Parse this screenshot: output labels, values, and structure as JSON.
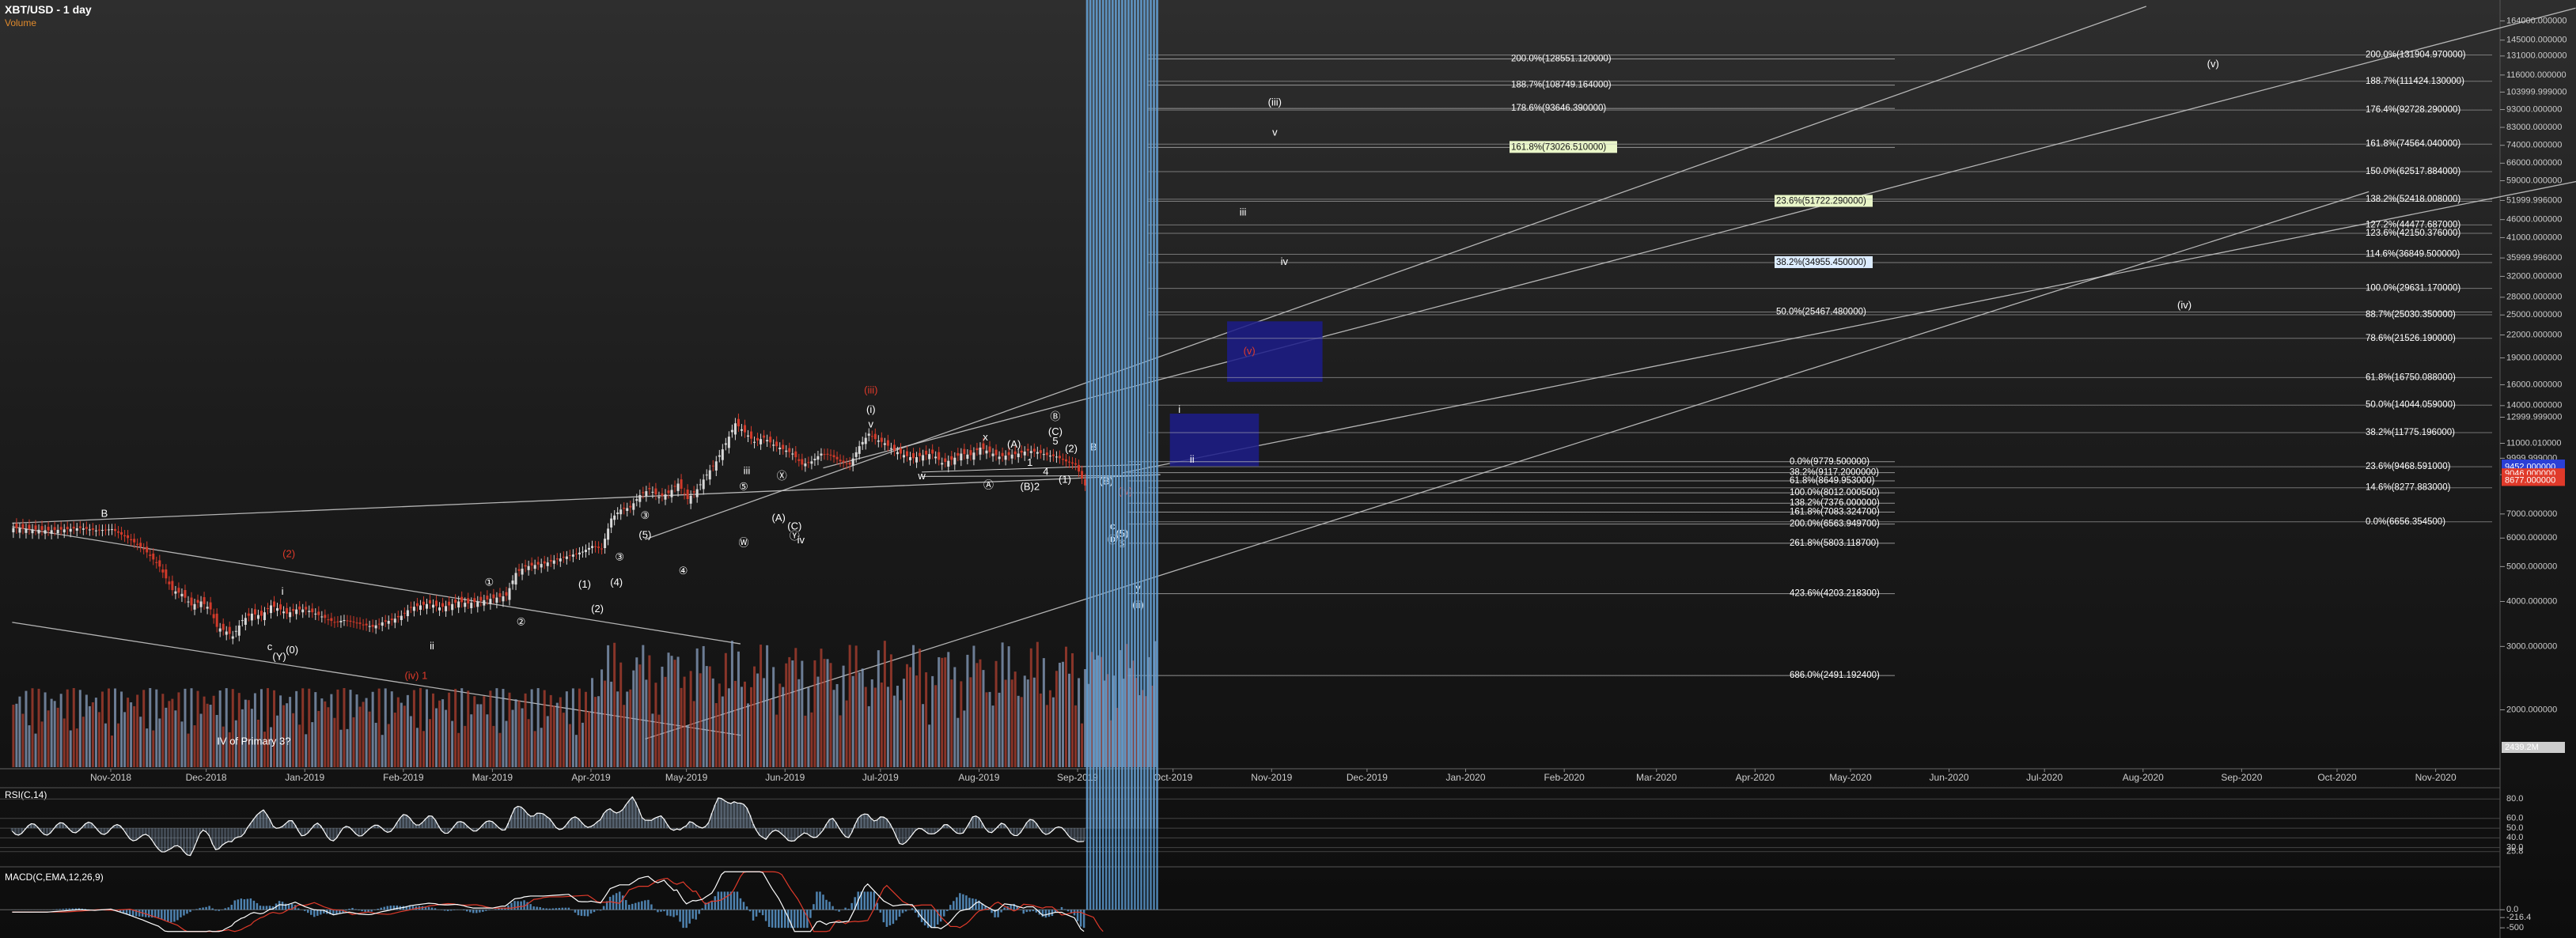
{
  "header": {
    "title": "XBT/USD - 1 day",
    "subtitle": "Volume"
  },
  "colors": {
    "up": "#d9d9d9",
    "down": "#d23a2a",
    "fib_line": "#bdbdbd",
    "channel": "#cfcfcf",
    "box": "#1c1c8a",
    "rsi_fill": "#8aa0b8",
    "macd_fast": "#ffffff",
    "macd_slow": "#e03a2a",
    "hist": "#5fa0d8",
    "volume_avg": "#b5651d"
  },
  "chart_data": {
    "type": "line",
    "title": "XBT/USD - 1 day",
    "price_axis": {
      "scale": "log",
      "ylim": [
        1400,
        180000
      ],
      "ticks": [
        "164000.000000",
        "145000.000000",
        "131000.000000",
        "116000.000000",
        "103999.999000",
        "93000.000000",
        "83000.000000",
        "74000.000000",
        "66000.000000",
        "59000.000000",
        "51999.996000",
        "46000.000000",
        "41000.000000",
        "35999.996000",
        "32000.000000",
        "28000.000000",
        "25000.000000",
        "22000.000000",
        "19000.000000",
        "16000.000000",
        "14000.000000",
        "12999.999000",
        "11000.010000",
        "9999.999000",
        "8999.999000",
        "7000.000000",
        "6000.000000",
        "5000.000000",
        "4000.000000",
        "3000.000000",
        "2000.000000"
      ],
      "tick_values": [
        164000,
        145000,
        131000,
        116000,
        104000,
        93000,
        83000,
        74000,
        66000,
        59000,
        52000,
        46000,
        41000,
        36000,
        32000,
        28000,
        25000,
        22000,
        19000,
        16000,
        14000,
        13000,
        11000,
        10000,
        9000,
        7000,
        6000,
        5000,
        4000,
        3000,
        2000
      ],
      "highlight_labels": [
        {
          "text": "9570.000000",
          "value": 9570,
          "color": "#2a3fd6"
        },
        {
          "text": "9452.000000",
          "value": 9452,
          "color": "#2a3fd6"
        },
        {
          "text": "9046.000000",
          "value": 9046,
          "color": "#e03a2a"
        },
        {
          "text": "8677.000000",
          "value": 8677,
          "color": "#e03a2a"
        },
        {
          "text": "2439.2M",
          "value": null,
          "color": "#cccccc"
        }
      ]
    },
    "time_axis": {
      "labels": [
        "Nov-2018",
        "Dec-2018",
        "Jan-2019",
        "Feb-2019",
        "Mar-2019",
        "Apr-2019",
        "May-2019",
        "Jun-2019",
        "Jul-2019",
        "Aug-2019",
        "Sep-2019",
        "Oct-2019",
        "Nov-2019",
        "Dec-2019",
        "Jan-2020",
        "Feb-2020",
        "Mar-2020",
        "Apr-2020",
        "May-2020",
        "Jun-2020",
        "Jul-2020",
        "Aug-2020",
        "Sep-2020",
        "Oct-2020",
        "Nov-2020"
      ],
      "label_days": [
        0,
        30,
        61,
        92,
        120,
        151,
        181,
        212,
        242,
        273,
        304,
        334,
        365,
        395,
        426,
        457,
        486,
        517,
        547,
        578,
        608,
        639,
        670,
        700,
        731
      ]
    },
    "price_series": {
      "name": "XBT/USD",
      "days": [
        -31,
        -20,
        -14,
        -10,
        -5,
        0,
        5,
        10,
        15,
        19,
        22,
        25,
        28,
        31,
        33,
        36,
        38,
        41,
        44,
        47,
        50,
        53,
        55,
        58,
        61,
        64,
        67,
        70,
        73,
        76,
        79,
        82,
        85,
        88,
        91,
        94,
        97,
        100,
        103,
        106,
        109,
        112,
        115,
        118,
        121,
        124,
        127,
        130,
        133,
        136,
        139,
        142,
        145,
        148,
        151,
        154,
        157,
        160,
        163,
        166,
        169,
        172,
        175,
        178,
        181,
        184,
        187,
        190,
        193,
        196,
        199,
        202,
        205,
        208,
        211,
        214,
        217,
        220,
        223,
        226,
        229,
        232,
        235,
        238,
        240,
        243,
        246,
        249,
        252,
        255,
        258,
        261,
        264,
        267,
        270,
        273,
        276,
        279,
        282,
        285,
        288,
        291,
        294,
        297,
        300,
        303,
        306,
        309,
        312,
        315,
        318,
        321,
        324,
        326,
        329
      ],
      "close": [
        6400,
        6300,
        6350,
        6400,
        6300,
        6350,
        6000,
        5600,
        5000,
        4300,
        4200,
        3900,
        4000,
        3800,
        3400,
        3300,
        3200,
        3550,
        3700,
        3650,
        3900,
        3800,
        3700,
        3800,
        3800,
        3700,
        3600,
        3500,
        3550,
        3500,
        3450,
        3400,
        3500,
        3550,
        3650,
        3850,
        3900,
        3950,
        3850,
        3900,
        4000,
        3950,
        4000,
        4050,
        4100,
        4150,
        4800,
        5000,
        5050,
        5100,
        5200,
        5300,
        5400,
        5500,
        5700,
        5600,
        6800,
        7200,
        7300,
        7900,
        8200,
        7800,
        8000,
        8500,
        7700,
        8200,
        9000,
        9800,
        11000,
        12500,
        11800,
        11100,
        11400,
        10900,
        10600,
        10300,
        9600,
        9800,
        10300,
        10200,
        9800,
        9600,
        10800,
        11700,
        11300,
        11000,
        10500,
        10200,
        10000,
        10200,
        10300,
        9700,
        9900,
        10300,
        10200,
        10700,
        10400,
        10100,
        10200,
        10300,
        10500,
        10400,
        10200,
        10100,
        9800,
        9600,
        8400
      ],
      "ohlc_note": "approximate daily closes read from candlesticks"
    },
    "fib_left": [
      {
        "label": "200.0%(128551.120000)",
        "value": 128551.12
      },
      {
        "label": "188.7%(108749.164000)",
        "value": 108749.164
      },
      {
        "label": "178.6%(93646.390000)",
        "value": 93646.39
      },
      {
        "label": "161.8%(73026.510000)",
        "value": 73026.51,
        "highlight": "#e9f6c8"
      },
      {
        "label": "0.0%(9779.500000)",
        "value": 9779.5
      },
      {
        "label": "38.2%(9117.2000000)",
        "value": 9117.2
      },
      {
        "label": "61.8%(8649.953000)",
        "value": 8649.953
      },
      {
        "label": "100.0%(8012.000500)",
        "value": 8012.0005
      },
      {
        "label": "138.2%(7376.000000)",
        "value": 7500
      },
      {
        "label": "161.8%(7083.324700)",
        "value": 7083.3247
      },
      {
        "label": "200.0%(6563.949700)",
        "value": 6563.9497
      },
      {
        "label": "261.8%(5803.118700)",
        "value": 5803.1187
      },
      {
        "label": "423.6%(4203.218300)",
        "value": 4203.2183
      },
      {
        "label": "686.0%(2491.192400)",
        "value": 2491.1924
      }
    ],
    "fib_mid": [
      {
        "label": "23.6%(51722.290000)",
        "value": 51722.29,
        "highlight": "#e9f6c8"
      },
      {
        "label": "38.2%(34955.450000)",
        "value": 34955.45,
        "highlight": "#dcecff"
      },
      {
        "label": "50.0%(25467.480000)",
        "value": 25467.48
      }
    ],
    "fib_right": [
      {
        "label": "200.0%(131904.970000)",
        "value": 131904.97
      },
      {
        "label": "188.7%(111424.130000)",
        "value": 111424.13
      },
      {
        "label": "176.4%(92728.290000)",
        "value": 92728.29
      },
      {
        "label": "161.8%(74564.040000)",
        "value": 74564.04
      },
      {
        "label": "150.0%(62517.884000)",
        "value": 62517.884
      },
      {
        "label": "138.2%(52418.008000)",
        "value": 52418.008
      },
      {
        "label": "127.2%(44477.687000)",
        "value": 44477.687
      },
      {
        "label": "123.6%(42150.376000)",
        "value": 42150.376
      },
      {
        "label": "114.6%(36849.500000)",
        "value": 36849.5
      },
      {
        "label": "100.0%(29631.170000)",
        "value": 29631.17
      },
      {
        "label": "88.7%(25030.350000)",
        "value": 25030.35
      },
      {
        "label": "78.6%(21526.190000)",
        "value": 21526.19
      },
      {
        "label": "61.8%(16750.088000)",
        "value": 16750.088
      },
      {
        "label": "50.0%(14044.059000)",
        "value": 14044.059
      },
      {
        "label": "38.2%(11775.196000)",
        "value": 11775.196
      },
      {
        "label": "23.6%(9468.591000)",
        "value": 9468.591
      },
      {
        "label": "14.6%(8277.883000)",
        "value": 8277.883
      },
      {
        "label": "0.0%(6656.354500)",
        "value": 6656.3545
      }
    ],
    "wave_labels": [
      {
        "text": "(iii)",
        "day": 366,
        "value": 97000,
        "color": "#ffffff"
      },
      {
        "text": "v",
        "day": 366,
        "value": 80000,
        "color": "#ffffff"
      },
      {
        "text": "iii",
        "day": 356,
        "value": 48000,
        "color": "#ffffff"
      },
      {
        "text": "iv",
        "day": 369,
        "value": 35000,
        "color": "#ffffff"
      },
      {
        "text": "(v)",
        "day": 661,
        "value": 124000,
        "color": "#ffffff"
      },
      {
        "text": "(iv)",
        "day": 652,
        "value": 26500,
        "color": "#ffffff"
      },
      {
        "text": "(v)",
        "day": 358,
        "value": 19800,
        "color": "#e03a2a"
      },
      {
        "text": "i",
        "day": 336,
        "value": 13600,
        "color": "#ffffff"
      },
      {
        "text": "ii",
        "day": 340,
        "value": 9900,
        "color": "#ffffff"
      },
      {
        "text": "(iv)",
        "day": 319,
        "value": 8050,
        "color": "#e03a2a"
      },
      {
        "text": "(i)",
        "day": 239,
        "value": 13600,
        "color": "#ffffff"
      },
      {
        "text": "v",
        "day": 239,
        "value": 12400,
        "color": "#ffffff"
      },
      {
        "text": "(iii)",
        "day": 239,
        "value": 15400,
        "color": "#e03a2a"
      },
      {
        "text": "x",
        "day": 275,
        "value": 11400,
        "color": "#ffffff"
      },
      {
        "text": "w",
        "day": 255,
        "value": 8900,
        "color": "#ffffff"
      },
      {
        "text": "(ii)",
        "day": 323,
        "value": 3900,
        "color": "#ffffff"
      },
      {
        "text": "y",
        "day": 323,
        "value": 4350,
        "color": "#ffffff"
      },
      {
        "text": "iii",
        "day": 200,
        "value": 9200,
        "color": "#ffffff"
      },
      {
        "text": "iv",
        "day": 217,
        "value": 5900,
        "color": "#ffffff"
      },
      {
        "text": "i",
        "day": 54,
        "value": 4250,
        "color": "#ffffff"
      },
      {
        "text": "ii",
        "day": 101,
        "value": 3000,
        "color": "#ffffff"
      },
      {
        "text": "(0)",
        "day": 57,
        "value": 2920,
        "color": "#ffffff"
      },
      {
        "text": "(Y)",
        "day": 53,
        "value": 2800,
        "color": "#ffffff"
      },
      {
        "text": "c",
        "day": 50,
        "value": 2980,
        "color": "#ffffff"
      },
      {
        "text": "B",
        "day": -2,
        "value": 7000,
        "color": "#ffffff"
      },
      {
        "text": "(2)",
        "day": 56,
        "value": 5400,
        "color": "#e03a2a"
      },
      {
        "text": "(iv) 1",
        "day": 96,
        "value": 2480,
        "color": "#e03a2a"
      },
      {
        "text": "①",
        "day": 119,
        "value": 4500,
        "color": "#ffffff"
      },
      {
        "text": "②",
        "day": 129,
        "value": 3500,
        "color": "#ffffff"
      },
      {
        "text": "(1)",
        "day": 149,
        "value": 4450,
        "color": "#ffffff"
      },
      {
        "text": "(2)",
        "day": 153,
        "value": 3800,
        "color": "#ffffff"
      },
      {
        "text": "③",
        "day": 160,
        "value": 5300,
        "color": "#ffffff"
      },
      {
        "text": "(4)",
        "day": 159,
        "value": 4500,
        "color": "#ffffff"
      },
      {
        "text": "③",
        "day": 168,
        "value": 6900,
        "color": "#ffffff"
      },
      {
        "text": "(5)",
        "day": 168,
        "value": 6100,
        "color": "#ffffff"
      },
      {
        "text": "④",
        "day": 180,
        "value": 4850,
        "color": "#ffffff"
      },
      {
        "text": "⑤",
        "day": 199,
        "value": 8300,
        "color": "#ffffff"
      },
      {
        "text": "Ⓦ",
        "day": 199,
        "value": 5800,
        "color": "#ffffff"
      },
      {
        "text": "Ⓧ",
        "day": 211,
        "value": 8900,
        "color": "#ffffff"
      },
      {
        "text": "(A)",
        "day": 210,
        "value": 6800,
        "color": "#ffffff"
      },
      {
        "text": "(C)",
        "day": 215,
        "value": 6450,
        "color": "#ffffff"
      },
      {
        "text": "Ⓨ",
        "day": 215,
        "value": 6050,
        "color": "#ffffff"
      },
      {
        "text": "Ⓑ",
        "day": 297,
        "value": 13000,
        "color": "#ffffff"
      },
      {
        "text": "(C)",
        "day": 297,
        "value": 11800,
        "color": "#ffffff"
      },
      {
        "text": "5",
        "day": 297,
        "value": 11100,
        "color": "#ffffff"
      },
      {
        "text": "(2)",
        "day": 302,
        "value": 10600,
        "color": "#ffffff"
      },
      {
        "text": "B",
        "day": 309,
        "value": 10700,
        "color": "#ffffff"
      },
      {
        "text": "(A)",
        "day": 284,
        "value": 10900,
        "color": "#ffffff"
      },
      {
        "text": "1",
        "day": 289,
        "value": 9700,
        "color": "#ffffff"
      },
      {
        "text": "4",
        "day": 294,
        "value": 9150,
        "color": "#ffffff"
      },
      {
        "text": "(1)",
        "day": 300,
        "value": 8700,
        "color": "#ffffff"
      },
      {
        "text": "(B)2",
        "day": 289,
        "value": 8300,
        "color": "#ffffff"
      },
      {
        "text": "Ⓐ",
        "day": 276,
        "value": 8400,
        "color": "#ffffff"
      },
      {
        "text": "(B)",
        "day": 313,
        "value": 8600,
        "color": "#ffffff"
      },
      {
        "text": "c",
        "day": 315,
        "value": 6450,
        "color": "#ffffff"
      },
      {
        "text": "(5)",
        "day": 318,
        "value": 6150,
        "color": "#ffffff"
      },
      {
        "text": "Ⓓ",
        "day": 315,
        "value": 5900,
        "color": "#ffffff"
      },
      {
        "text": "⑤",
        "day": 318,
        "value": 5750,
        "color": "#ffffff"
      },
      {
        "text": "IV of Primary 3?",
        "day": 45,
        "value": 1630,
        "color": "#ffffff"
      }
    ],
    "target_boxes": [
      {
        "day_start": 351,
        "day_end": 381,
        "high": 24000,
        "low": 16300
      },
      {
        "day_start": 333,
        "day_end": 361,
        "high": 13300,
        "low": 9500
      }
    ],
    "rsi": {
      "label": "RSI(C,14)",
      "ticks": [
        "80.0",
        "60.0",
        "50.0",
        "40.0",
        "30.0",
        "25.8"
      ],
      "tick_values": [
        80,
        60,
        50,
        40,
        30,
        25.8
      ],
      "ylim": [
        15,
        90
      ]
    },
    "macd": {
      "label": "MACD(C,EMA,12,26,9)",
      "ticks": [
        "0.0",
        "-216.4",
        "-500"
      ],
      "tick_values": [
        0,
        -216.4,
        -500
      ],
      "ylim": [
        -650,
        1100
      ]
    },
    "volume_label": "Volume"
  }
}
